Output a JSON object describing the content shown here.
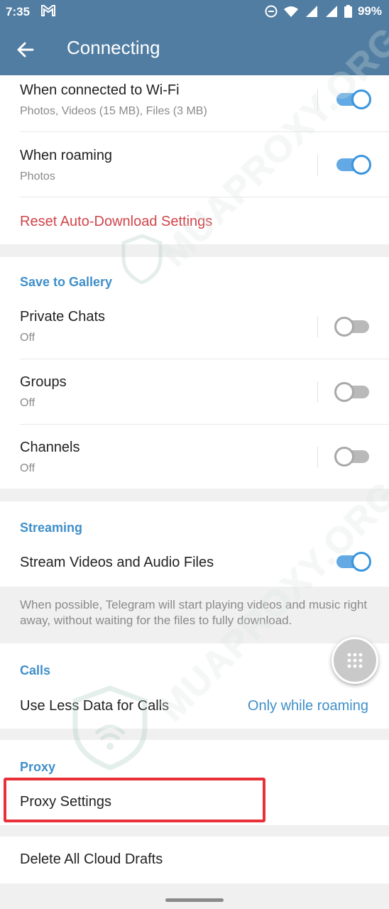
{
  "status_bar": {
    "time": "7:35",
    "battery": "99%"
  },
  "app_bar": {
    "title": "Connecting"
  },
  "auto_download": {
    "wifi": {
      "title": "When connected to Wi-Fi",
      "subtitle": "Photos, Videos (15 MB), Files (3 MB)",
      "enabled": true
    },
    "roaming": {
      "title": "When roaming",
      "subtitle": "Photos",
      "enabled": true
    },
    "reset_label": "Reset Auto-Download Settings"
  },
  "save_to_gallery": {
    "header": "Save to Gallery",
    "private_chats": {
      "title": "Private Chats",
      "subtitle": "Off",
      "enabled": false
    },
    "groups": {
      "title": "Groups",
      "subtitle": "Off",
      "enabled": false
    },
    "channels": {
      "title": "Channels",
      "subtitle": "Off",
      "enabled": false
    }
  },
  "streaming": {
    "header": "Streaming",
    "stream_videos": {
      "title": "Stream Videos and Audio Files",
      "enabled": true
    },
    "info": "When possible, Telegram will start playing videos and music right away, without waiting for the files to fully download."
  },
  "calls": {
    "header": "Calls",
    "use_less_data": {
      "title": "Use Less Data for Calls",
      "value": "Only while roaming"
    }
  },
  "proxy": {
    "header": "Proxy",
    "settings_label": "Proxy Settings"
  },
  "drafts": {
    "delete_label": "Delete All Cloud Drafts"
  },
  "watermark": {
    "text": "MUAPROXY.ORG"
  },
  "colors": {
    "app_bar": "#517da2",
    "accent_blue": "#3f8fc9",
    "reset_red": "#d0454a",
    "highlight_red": "#e8303a"
  },
  "icons": {
    "back": "arrow-left-icon",
    "mail": "gmail-icon",
    "fab": "grid-dots-icon"
  }
}
